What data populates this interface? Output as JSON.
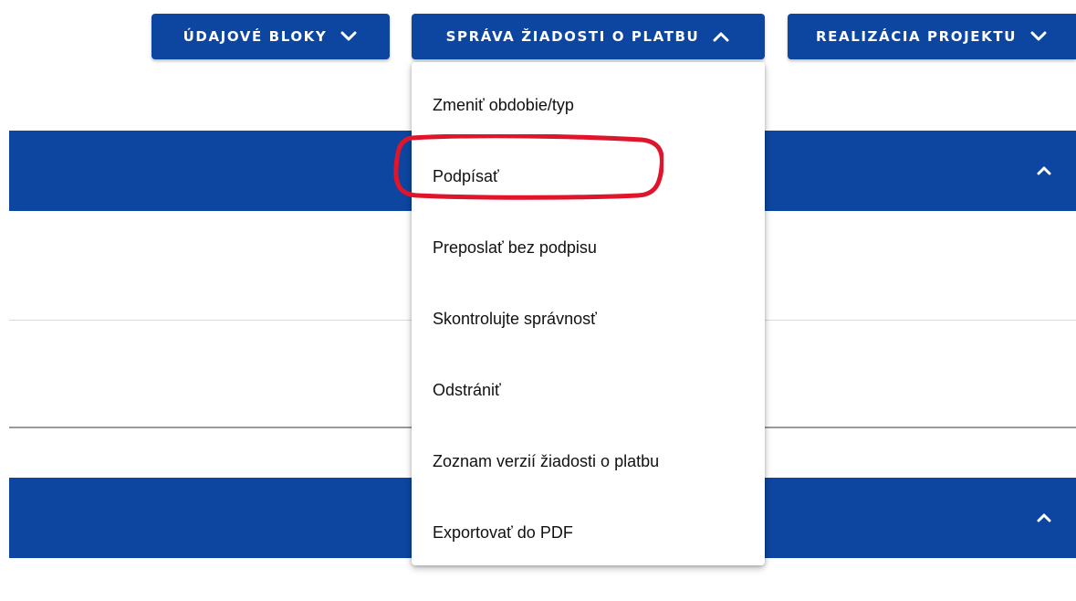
{
  "toolbar": {
    "buttons": [
      {
        "label": "ÚDAJOVÉ BLOKY",
        "icon": "chevron-down-icon"
      },
      {
        "label": "SPRÁVA ŽIADOSTI O PLATBU",
        "icon": "chevron-up-icon"
      },
      {
        "label": "REALIZÁCIA PROJEKTU",
        "icon": "chevron-down-icon"
      }
    ]
  },
  "menu": {
    "items": [
      {
        "label": "Zmeniť obdobie/typ"
      },
      {
        "label": "Podpísať",
        "highlighted": true
      },
      {
        "label": "Preposlať bez podpisu"
      },
      {
        "label": "Skontrolujte správnosť"
      },
      {
        "label": "Odstrániť"
      },
      {
        "label": "Zoznam verzií žiadosti o platbu"
      },
      {
        "label": "Exportovať do PDF"
      }
    ]
  },
  "sections": [
    {
      "icon": "chevron-up-icon"
    },
    {
      "icon": "chevron-up-icon"
    }
  ],
  "colors": {
    "primary": "#0c46a0",
    "highlight": "#e0142a",
    "text": "#111111",
    "background": "#ffffff"
  }
}
